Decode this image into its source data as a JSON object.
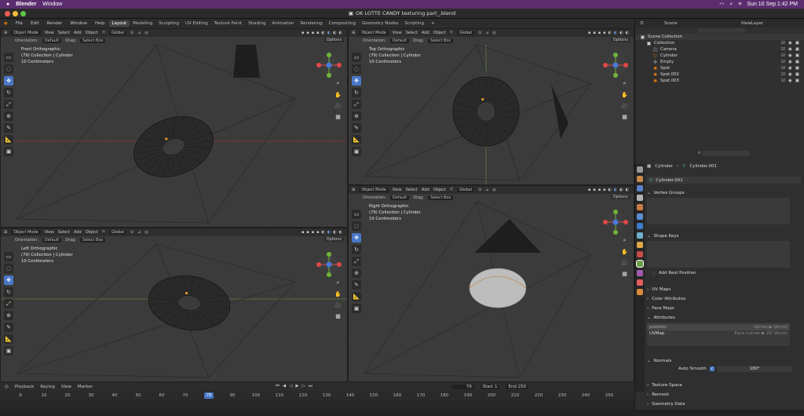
{
  "mac": {
    "app": "Blender",
    "menu": "Window",
    "datetime": "Sun 10 Sep  1:42 PM"
  },
  "window_title": "OK LOTTE CANDY texturing part_.blend",
  "topbar": {
    "menus": [
      "File",
      "Edit",
      "Render",
      "Window",
      "Help"
    ],
    "workspaces": [
      "Layout",
      "Modeling",
      "Sculpting",
      "UV Editing",
      "Texture Paint",
      "Shading",
      "Animation",
      "Rendering",
      "Compositing",
      "Geometry Nodes",
      "Scripting"
    ],
    "add_tab": "+"
  },
  "viewport_header": {
    "mode": "Object Mode",
    "menus": [
      "View",
      "Select",
      "Add",
      "Object"
    ],
    "transform": "Global",
    "orientation_label": "Orientation:",
    "orientation_value": "Default",
    "drag_label": "Drag:",
    "drag_value": "Select Box",
    "options": "Options"
  },
  "viewports": [
    {
      "view": "Front Orthographic",
      "collection": "(79) Collection | Cylinder",
      "scale": "10 Centimeters"
    },
    {
      "view": "Top Orthographic",
      "collection": "(79) Collection | Cylinder",
      "scale": "10 Centimeters"
    },
    {
      "view": "Left Orthographic",
      "collection": "(79) Collection | Cylinder",
      "scale": "10 Centimeters"
    },
    {
      "view": "Right Orthographic",
      "collection": "(79) Collection | Cylinder",
      "scale": "10 Centimeters"
    }
  ],
  "timeline": {
    "menus": [
      "Playback",
      "Keying",
      "View",
      "Marker"
    ],
    "current_frame": "79",
    "start_label": "Start",
    "start": "1",
    "end_label": "End",
    "end": "250",
    "ticks": [
      "0",
      "10",
      "20",
      "30",
      "40",
      "50",
      "60",
      "70",
      "79",
      "90",
      "100",
      "110",
      "120",
      "130",
      "140",
      "150",
      "160",
      "170",
      "180",
      "190",
      "200",
      "210",
      "220",
      "230",
      "240",
      "250"
    ]
  },
  "outliner": {
    "search_label": "Scene",
    "view_layer": "ViewLayer",
    "items": [
      {
        "label": "Scene Collection",
        "depth": 0
      },
      {
        "label": "Collection",
        "depth": 1
      },
      {
        "label": "Camera",
        "depth": 2
      },
      {
        "label": "Cylinder",
        "depth": 2
      },
      {
        "label": "Empty",
        "depth": 2
      },
      {
        "label": "Spot",
        "depth": 2
      },
      {
        "label": "Spot.002",
        "depth": 2
      },
      {
        "label": "Spot.003",
        "depth": 2
      }
    ]
  },
  "properties": {
    "object": "Cylinder",
    "mesh": "Cylinder.001",
    "mesh_field": "Cylinder.001",
    "vertex_groups": "Vertex Groups",
    "shape_keys": "Shape Keys",
    "add_rest_position": "Add Rest Position",
    "uv_maps": "UV Maps",
    "color_attributes": "Color Attributes",
    "face_maps": "Face Maps",
    "attributes": "Attributes",
    "attribute_rows": [
      {
        "name": "position",
        "domain": "Vertex ▶ Vector"
      },
      {
        "name": "UVMap",
        "domain": "Face Corner ▶ 2D Vector"
      }
    ],
    "normals": "Normals",
    "auto_smooth": "Auto Smooth",
    "auto_smooth_angle": "180°",
    "texture_space": "Texture Space",
    "remesh": "Remesh",
    "geometry_data": "Geometry Data"
  },
  "colors": {
    "accent": "#4a78c8",
    "mac_bar": "#5b2d6e",
    "viewport": "#3b3b3b"
  }
}
